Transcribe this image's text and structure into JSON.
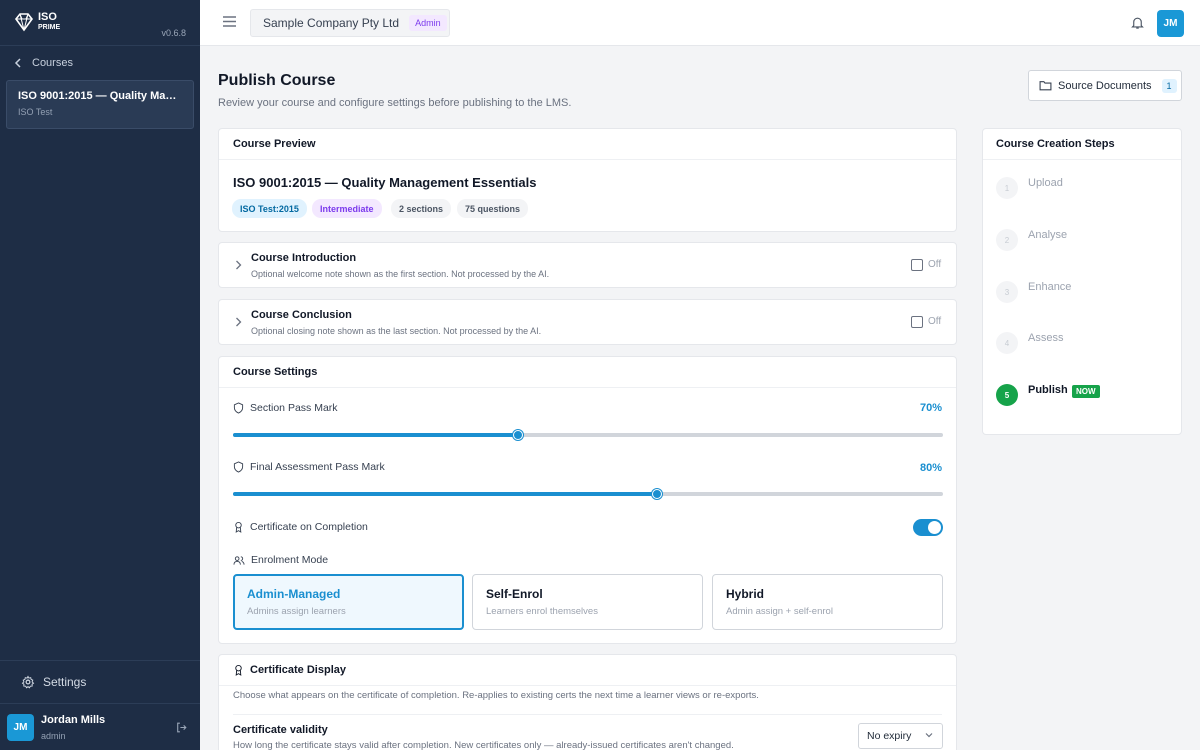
{
  "app": {
    "logo_line1": "ISO",
    "logo_line2": "PRIME",
    "version": "v0.6.8"
  },
  "sidebar": {
    "back_label": "Courses",
    "course": {
      "title": "ISO 9001:2015 — Quality Manag...",
      "subtitle": "ISO Test"
    },
    "settings_label": "Settings",
    "user": {
      "initials": "JM",
      "name": "Jordan Mills",
      "role": "admin"
    }
  },
  "topbar": {
    "company": "Sample Company Pty Ltd",
    "company_badge": "Admin",
    "avatar_initials": "JM"
  },
  "header": {
    "title": "Publish Course",
    "subtitle": "Review your course and configure settings before publishing to the LMS.",
    "source_docs_label": "Source Documents",
    "source_docs_count": "1"
  },
  "preview": {
    "heading": "Course Preview",
    "course_title": "ISO 9001:2015 — Quality Management Essentials",
    "tags": [
      {
        "label": "ISO Test:2015",
        "color": "#0369a1",
        "bg": "#e0f2fe"
      },
      {
        "label": "Intermediate",
        "color": "#7c3aed",
        "bg": "#f3e8ff"
      },
      {
        "label": "2 sections",
        "color": "#4b5563",
        "bg": "#f3f4f6"
      },
      {
        "label": "75 questions",
        "color": "#4b5563",
        "bg": "#f3f4f6"
      }
    ]
  },
  "intro": {
    "title": "Course Introduction",
    "description": "Optional welcome note shown as the first section. Not processed by the AI.",
    "state": "Off"
  },
  "conclusion": {
    "title": "Course Conclusion",
    "description": "Optional closing note shown as the last section. Not processed by the AI.",
    "state": "Off"
  },
  "settings": {
    "heading": "Course Settings",
    "section_pass": {
      "label": "Section Pass Mark",
      "value_text": "70%",
      "fraction": 0.402
    },
    "final_pass": {
      "label": "Final Assessment Pass Mark",
      "value_text": "80%",
      "fraction": 0.597
    },
    "certificate": {
      "label": "Certificate on Completion",
      "enabled": true
    },
    "enrolment": {
      "label": "Enrolment Mode",
      "options": [
        {
          "title": "Admin-Managed",
          "desc": "Admins assign learners",
          "selected": true
        },
        {
          "title": "Self-Enrol",
          "desc": "Learners enrol themselves",
          "selected": false
        },
        {
          "title": "Hybrid",
          "desc": "Admin assign + self-enrol",
          "selected": false
        }
      ]
    }
  },
  "certificate_display": {
    "heading": "Certificate Display",
    "description": "Choose what appears on the certificate of completion. Re-applies to existing certs the next time a learner views or re-exports.",
    "validity_label": "Certificate validity",
    "validity_desc": "How long the certificate stays valid after completion. New certificates only — already-issued certificates aren't changed.",
    "validity_value": "No expiry"
  },
  "steps": {
    "heading": "Course Creation Steps",
    "items": [
      {
        "num": "1",
        "label": "Upload"
      },
      {
        "num": "2",
        "label": "Analyse"
      },
      {
        "num": "3",
        "label": "Enhance"
      },
      {
        "num": "4",
        "label": "Assess"
      },
      {
        "num": "5",
        "label": "Publish"
      }
    ],
    "current_badge": "NOW"
  }
}
